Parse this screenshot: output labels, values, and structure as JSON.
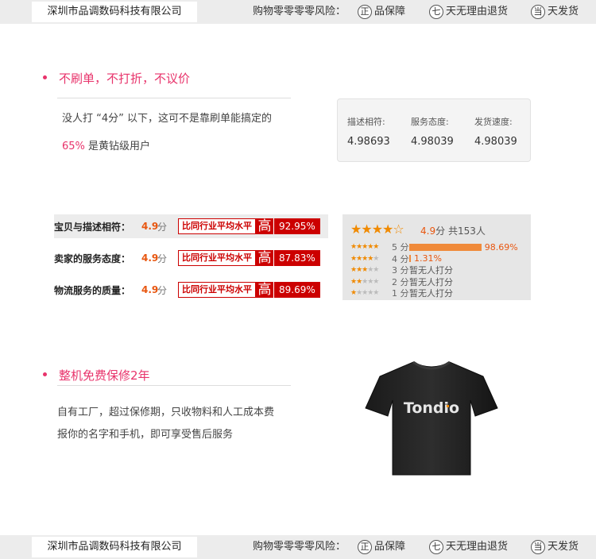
{
  "header": {
    "company": "深圳市品调数码科技有限公司",
    "promise": "购物零零零零风险：",
    "badges": [
      {
        "icon": "正",
        "label": "品保障"
      },
      {
        "icon": "七",
        "label": "天无理由退货"
      },
      {
        "icon": "当",
        "label": "天发货"
      }
    ]
  },
  "section1": {
    "title": "不刷单，不打折，不议价",
    "line1": "没人打 “4分” 以下，这可不是靠刷单能搞定的",
    "line2_pct": "65%",
    "line2_rest": "是黄钻级用户"
  },
  "rating": {
    "items": [
      {
        "label": "描述相符:",
        "value": "4.98693"
      },
      {
        "label": "服务态度:",
        "value": "4.98039"
      },
      {
        "label": "发货速度:",
        "value": "4.98039"
      }
    ]
  },
  "scores": {
    "rows": [
      {
        "label": "宝贝与描述相符：",
        "score": "4.9",
        "unit": "分",
        "compare": "比同行业平均水平",
        "high": "高",
        "pct": "92.95%"
      },
      {
        "label": "卖家的服务态度：",
        "score": "4.9",
        "unit": "分",
        "compare": "比同行业平均水平",
        "high": "高",
        "pct": "87.83%"
      },
      {
        "label": "物流服务的质量：",
        "score": "4.9",
        "unit": "分",
        "compare": "比同行业平均水平",
        "high": "高",
        "pct": "89.69%"
      }
    ],
    "summary_score": "4.9",
    "summary_unit": "分",
    "summary_count": "共153人",
    "distribution": [
      {
        "stars": 5,
        "label": "5 分",
        "pct": "98.69%",
        "fraction": 0.9869
      },
      {
        "stars": 4,
        "label": "4 分",
        "pct": "1.31%",
        "fraction": 0.0131
      },
      {
        "stars": 3,
        "label": "3 分",
        "none": "暂无人打分"
      },
      {
        "stars": 2,
        "label": "2 分",
        "none": "暂无人打分"
      },
      {
        "stars": 1,
        "label": "1 分",
        "none": "暂无人打分"
      }
    ]
  },
  "section2": {
    "title": "整机免费保修2年",
    "line1": "自有工厂，超过保修期，只收物料和人工成本费",
    "line2": "报你的名字和手机，即可享受售后服务",
    "shirt_text": "Tondio"
  },
  "footer": {
    "company": "深圳市品调数码科技有限公司",
    "promise": "购物零零零零风险：",
    "badges": [
      {
        "icon": "正",
        "label": "品保障"
      },
      {
        "icon": "七",
        "label": "天无理由退货"
      },
      {
        "icon": "当",
        "label": "天发货"
      }
    ]
  }
}
